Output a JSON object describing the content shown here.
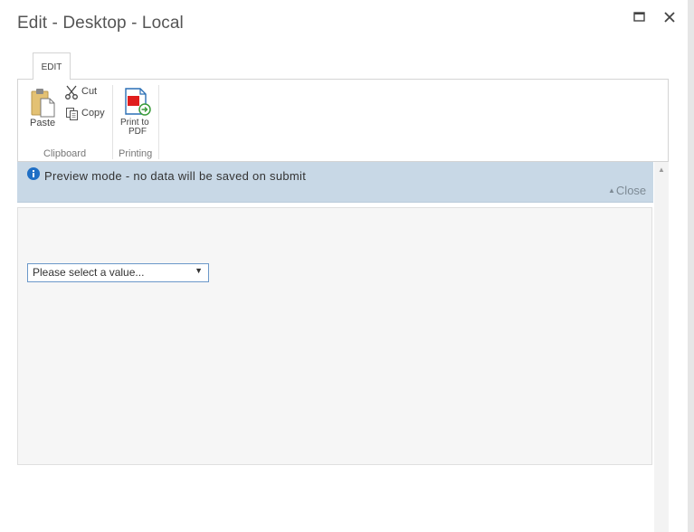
{
  "dialog": {
    "title": "Edit - Desktop - Local"
  },
  "window_controls": {
    "maximize_icon": "maximize-icon",
    "close_icon": "close-icon"
  },
  "ribbon": {
    "tabs": [
      {
        "label": "EDIT",
        "active": true
      }
    ],
    "groups": [
      {
        "label": "Clipboard",
        "buttons": [
          {
            "label": "Paste",
            "icon": "paste-icon"
          },
          {
            "label": "Cut",
            "icon": "cut-icon"
          },
          {
            "label": "Copy",
            "icon": "copy-icon"
          }
        ]
      },
      {
        "label": "Printing",
        "buttons": [
          {
            "label_line1": "Print to",
            "label_line2": "PDF",
            "icon": "print-to-pdf-icon"
          }
        ]
      }
    ]
  },
  "preview": {
    "message": "Preview mode - no data will be saved on submit",
    "close_label": "Close",
    "info_icon": "info-icon"
  },
  "form": {
    "select": {
      "selected_text": "Please select a value..."
    }
  },
  "colors": {
    "preview_bar": "#c8d8e6",
    "info_icon": "#1f6fc5",
    "select_border": "#6b98c9",
    "form_background": "#f6f6f6"
  }
}
